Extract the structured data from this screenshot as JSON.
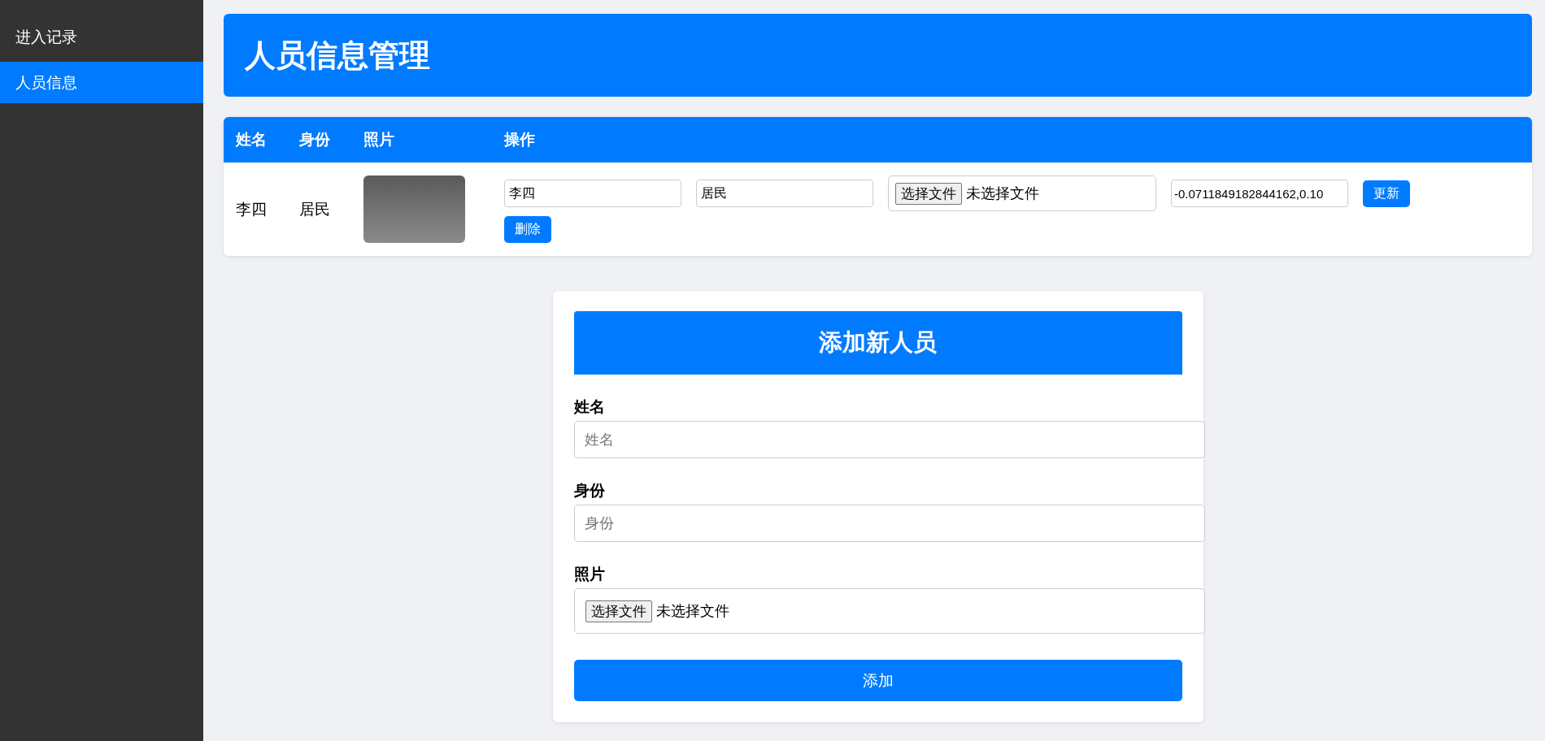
{
  "sidebar": {
    "items": [
      {
        "label": "进入记录",
        "selected": false
      },
      {
        "label": "人员信息",
        "selected": true
      }
    ]
  },
  "header": {
    "title": "人员信息管理"
  },
  "table": {
    "columns": [
      "姓名",
      "身份",
      "照片",
      "操作"
    ],
    "rows": [
      {
        "name": "李四",
        "identity": "居民",
        "edit": {
          "name_value": "李四",
          "identity_value": "居民",
          "file_button": "选择文件",
          "file_status": "未选择文件",
          "embedding_value": "-0.0711849182844162,0.10",
          "update_button": "更新",
          "delete_button": "删除"
        }
      }
    ]
  },
  "form": {
    "title": "添加新人员",
    "fields": [
      {
        "kind": "text",
        "label": "姓名",
        "placeholder": "姓名"
      },
      {
        "kind": "text",
        "label": "身份",
        "placeholder": "身份"
      },
      {
        "kind": "file",
        "label": "照片",
        "file_button": "选择文件",
        "file_status": "未选择文件"
      }
    ],
    "submit": "添加"
  }
}
